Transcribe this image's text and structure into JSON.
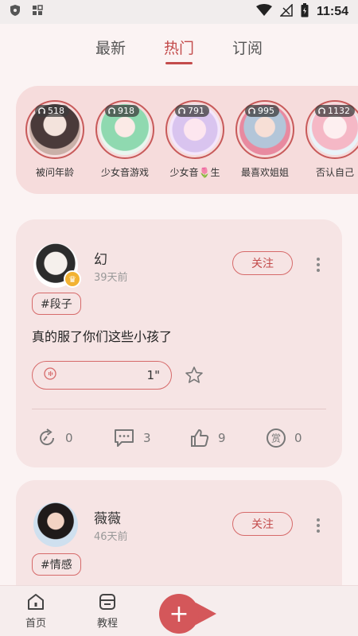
{
  "status_bar": {
    "time": "11:54"
  },
  "tabs": [
    {
      "label": "最新",
      "active": false
    },
    {
      "label": "热门",
      "active": true
    },
    {
      "label": "订阅",
      "active": false
    }
  ],
  "stories": [
    {
      "count": "518",
      "name": "被问年龄"
    },
    {
      "count": "918",
      "name": "少女音游戏"
    },
    {
      "count": "791",
      "name": "少女音🌷生"
    },
    {
      "count": "995",
      "name": "最喜欢姐姐"
    },
    {
      "count": "1132",
      "name": "否认自己"
    }
  ],
  "posts": [
    {
      "username": "幻",
      "time_ago": "39天前",
      "follow_label": "关注",
      "tag": "#段子",
      "text": "真的服了你们这些小孩了",
      "voice_duration": "1\"",
      "reposts": "0",
      "comments": "3",
      "likes": "9",
      "rewards": "0"
    },
    {
      "username": "薇薇",
      "time_ago": "46天前",
      "follow_label": "关注",
      "tag": "#情感"
    }
  ],
  "bottom_nav": {
    "home": "首页",
    "tutorial": "教程",
    "add": "+"
  },
  "colors": {
    "accent": "#c34b4b",
    "card": "#f6e4e4",
    "stories_bg": "#f6dcdc"
  }
}
